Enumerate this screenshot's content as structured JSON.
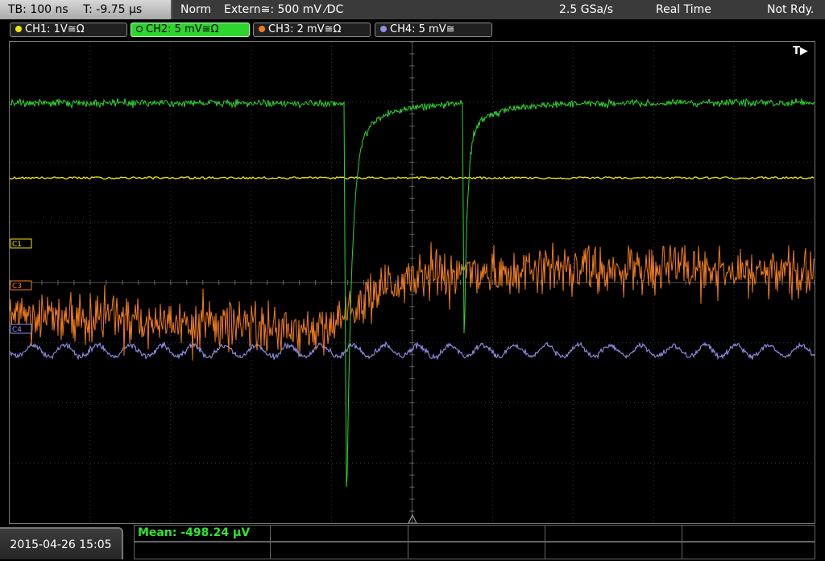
{
  "status": {
    "timebase": "TB: 100 ns",
    "trigger_time": "T: -9.75 µs",
    "mode": "Norm",
    "trigger_source": "Extern≅: 500 mV ⁄DC",
    "sample_rate": "2.5 GSa/s",
    "acq_mode": "Real Time",
    "trigger_state": "Not Rdy."
  },
  "channels": [
    {
      "label": "CH1: 1V≅Ω",
      "color": "#f2e600",
      "active": false
    },
    {
      "label": "CH2: 5 mV≅Ω",
      "color": "#2ed52e",
      "active": true
    },
    {
      "label": "CH3: 2 mV≅Ω",
      "color": "#f07d1a",
      "active": false
    },
    {
      "label": "CH4: 5 mV≅",
      "color": "#8f8fe8",
      "active": false
    }
  ],
  "markers": {
    "c1": "C1",
    "c3": "C3",
    "c4": "C4",
    "trigger": "T▶"
  },
  "measurement": {
    "mean": "Mean: -498.24 µV"
  },
  "datetime": "2015-04-26 15:05",
  "colors": {
    "grid": "#3a3a3a",
    "ch1": "#f2e600",
    "ch2": "#2ed52e",
    "ch3": "#f07d1a",
    "ch4": "#8f8fe8"
  }
}
